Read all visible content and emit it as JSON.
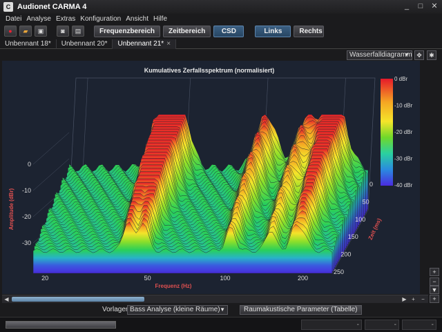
{
  "window": {
    "title": "Audionet CARMA 4",
    "icon_label": "C"
  },
  "menu": [
    "Datei",
    "Analyse",
    "Extras",
    "Konfiguration",
    "Ansicht",
    "Hilfe"
  ],
  "toolbar": {
    "icons": [
      "record-icon",
      "open-folder-icon",
      "save-icon",
      "camera-icon",
      "print-icon"
    ],
    "buttons": [
      {
        "label": "Frequenzbereich",
        "active": false
      },
      {
        "label": "Zeitbereich",
        "active": false
      },
      {
        "label": "CSD",
        "active": true
      },
      {
        "label": "Links",
        "active": true
      },
      {
        "label": "Rechts",
        "active": false
      }
    ]
  },
  "tabs": [
    {
      "label": "Unbennant 18*",
      "active": false
    },
    {
      "label": "Unbennant 20*",
      "active": false
    },
    {
      "label": "Unbennant 21*",
      "active": true
    }
  ],
  "view": {
    "selected": "Wasserfalldiagramm"
  },
  "chart_data": {
    "type": "area",
    "title": "Kumulatives Zerfallsspektrum (normalisiert)",
    "xlabel": "Frequenz (Hz)",
    "ylabel": "Amplitude (dBr)",
    "zlabel": "Zeit (ms)",
    "x_scale": "log",
    "x_ticks": [
      20,
      50,
      100,
      200
    ],
    "x_tick_labels": [
      "20",
      "50",
      "100",
      "200"
    ],
    "y_ticks": [
      "0",
      "-10",
      "-20",
      "-30"
    ],
    "z_ticks": [
      "0",
      "50",
      "100",
      "150",
      "200",
      "250"
    ],
    "colorbar_labels": [
      "0 dBr",
      "-10 dBr",
      "-20 dBr",
      "-30 dBr",
      "-40 dBr"
    ],
    "colorbar_range": [
      -40,
      0
    ],
    "colors": [
      "#e5192a",
      "#f5a623",
      "#f5e52a",
      "#8fe02a",
      "#2ad05a",
      "#28b4c8",
      "#3a5ae0",
      "#5028d8"
    ],
    "peaks_hz": [
      42,
      48,
      105,
      150,
      185,
      200
    ],
    "peak_levels_dbr": [
      -3,
      -4,
      -12,
      -14,
      -15,
      -18
    ],
    "time_range_ms": [
      0,
      250
    ]
  },
  "bottom": {
    "vorlagen_label": "Vorlagen",
    "vorlagen_value": "Bass Analyse (kleine Räume)",
    "raumakustik_button": "Raumakustische Parameter (Tabelle)"
  },
  "status": {
    "fields": [
      "-",
      "-",
      "-"
    ]
  }
}
